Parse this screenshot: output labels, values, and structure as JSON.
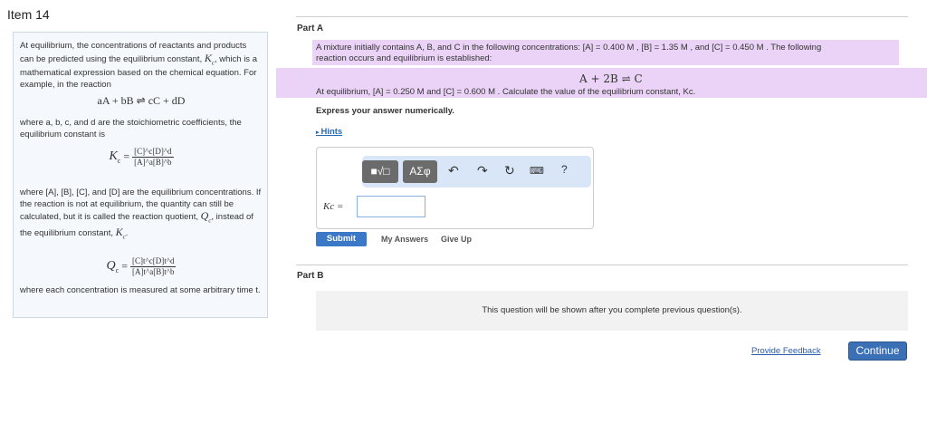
{
  "item_title": "Item 14",
  "intro": {
    "p1": "At equilibrium, the concentrations of reactants and products can be predicted using the equilibrium constant, K_c, which is a mathematical expression based on the chemical equation. For example, in the reaction",
    "p1_a": "At equilibrium, the concentrations of reactants and products can be predicted using the equilibrium constant,",
    "p1_b": ", which is a mathematical expression based on the chemical equation. For example, in the reaction",
    "Kc": "K",
    "c": "c",
    "general_reaction": "aA + bB ⇌ cC + dD",
    "p2": "where a, b, c, and d are the stoichiometric coefficients, the equilibrium constant is",
    "kc_num": "[C]^c[D]^d",
    "kc_den": "[A]^a[B]^b",
    "p3_a": "where [A], [B], [C], and [D] are the equilibrium concentrations. If the reaction is not at equilibrium, the quantity can still be calculated, but it is called the reaction quotient,",
    "Qc": "Q",
    "p3_b": ", instead of the equilibrium constant,",
    "qc_num": "[C]t^c[D]t^d",
    "qc_den": "[A]t^a[B]t^b",
    "p4": "where each concentration is measured at some arbitrary time t."
  },
  "partA": {
    "title": "Part A",
    "q1": "A mixture initially contains A, B, and C in the following concentrations: [A] = 0.400 M , [B] = 1.35 M , and [C] = 0.450 M . The following",
    "q2": "reaction occurs and equilibrium is established:",
    "reaction": "A + 2B ⇌ C",
    "q3": "At equilibrium, [A] = 0.250 M and [C] = 0.600 M . Calculate the value of the equilibrium constant, Kc.",
    "instruction": "Express your answer numerically.",
    "hints": "Hints",
    "answer_label": "Kc =",
    "answer_value": "",
    "toolbar": {
      "templates": "■√□",
      "greek": "ΑΣφ",
      "help": "?"
    },
    "submit": "Submit",
    "my_answers": "My Answers",
    "give_up": "Give Up"
  },
  "partB": {
    "title": "Part B",
    "locked_message": "This question will be shown after you complete previous question(s)."
  },
  "footer": {
    "feedback": "Provide Feedback",
    "continue": "Continue"
  }
}
